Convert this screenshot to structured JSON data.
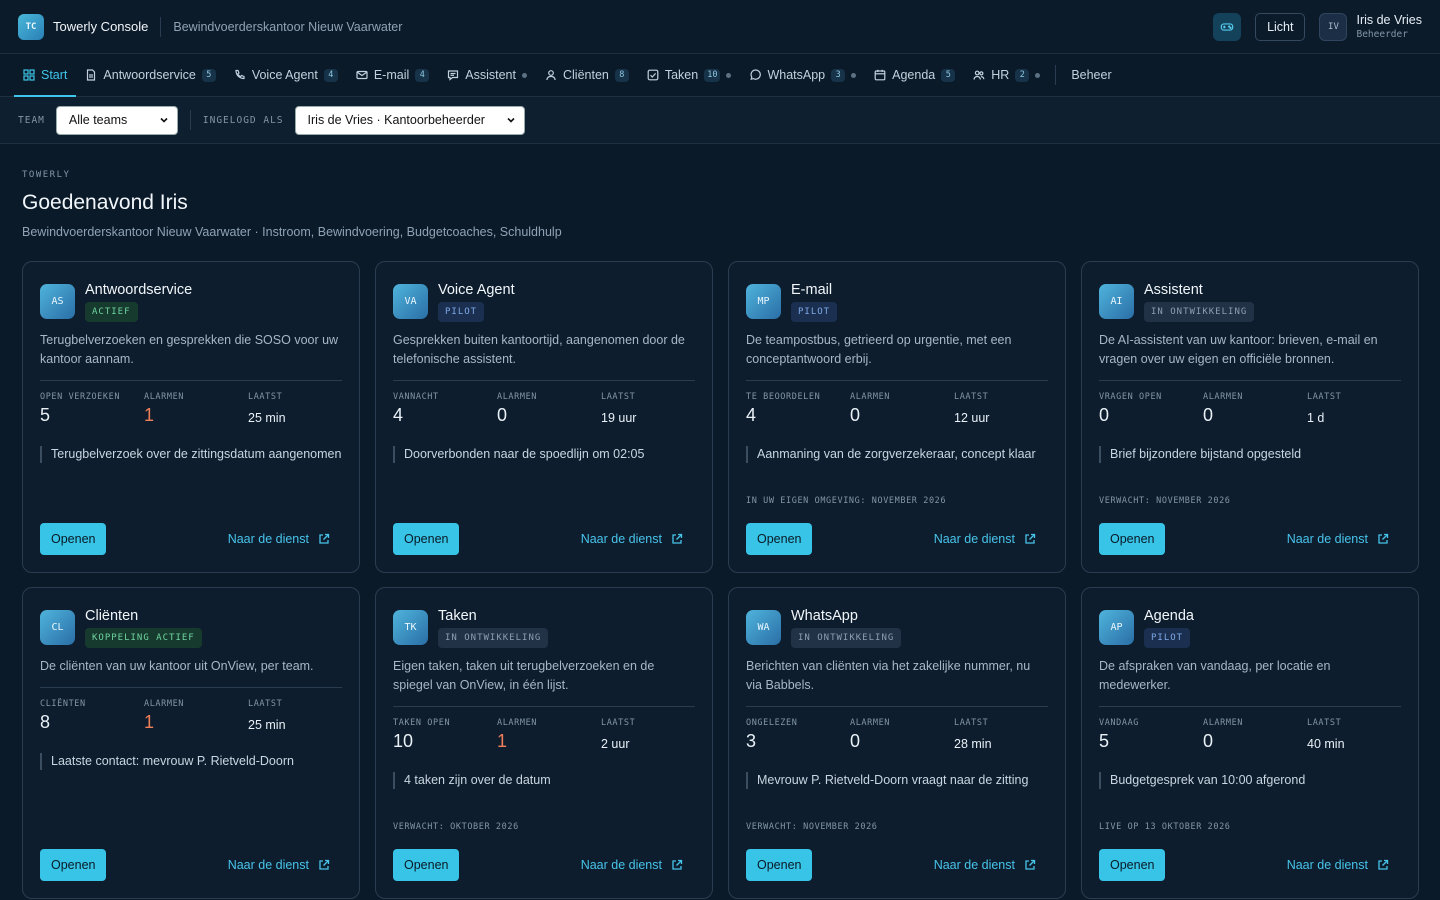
{
  "app": {
    "logo": "TC",
    "title": "Towerly Console",
    "org": "Bewindvoerderskantoor Nieuw Vaarwater"
  },
  "header": {
    "theme_button": "Licht",
    "theme_icon": "gamepad-icon",
    "user": {
      "initials": "IV",
      "name": "Iris de Vries",
      "role": "Beheerder"
    }
  },
  "nav": {
    "items": [
      {
        "label": "Start",
        "icon": "grid-icon",
        "active": true
      },
      {
        "label": "Antwoordservice",
        "icon": "document-icon",
        "badge": "5"
      },
      {
        "label": "Voice Agent",
        "icon": "phone-icon",
        "badge": "4"
      },
      {
        "label": "E-mail",
        "icon": "mail-icon",
        "badge": "4"
      },
      {
        "label": "Assistent",
        "icon": "chat-icon",
        "dot": true
      },
      {
        "label": "Cliënten",
        "icon": "user-icon",
        "badge": "8"
      },
      {
        "label": "Taken",
        "icon": "checkbox-icon",
        "badge": "10",
        "dot": true
      },
      {
        "label": "WhatsApp",
        "icon": "whatsapp-icon",
        "badge": "3",
        "dot": true
      },
      {
        "label": "Agenda",
        "icon": "calendar-icon",
        "badge": "5"
      },
      {
        "label": "HR",
        "icon": "people-icon",
        "badge": "2",
        "dot": true
      }
    ],
    "admin": "Beheer"
  },
  "filters": {
    "team_label": "TEAM",
    "team_value": "Alle teams",
    "login_label": "INGELOGD ALS",
    "login_value": "Iris de Vries · Kantoorbeheerder"
  },
  "page": {
    "eyebrow": "TOWERLY",
    "greeting": "Goedenavond Iris",
    "subline": "Bewindvoerderskantoor Nieuw Vaarwater · Instroom, Bewindvoering, Budgetcoaches, Schuldhulp"
  },
  "cards": [
    {
      "tile": "AS",
      "title": "Antwoordservice",
      "status": "ACTIEF",
      "status_color": "#6fd3a0",
      "desc": "Terugbelverzoeken en gesprekken die SOSO voor uw kantoor aannam.",
      "stat1_label": "OPEN VERZOEKEN",
      "stat1": "5",
      "alarm_label": "ALARMEN",
      "alarm": "1",
      "last_label": "LAATST",
      "last": "25 min",
      "note": "Terugbelverzoek over de zittingsdatum aangenomen",
      "expect": "",
      "open": "Openen",
      "link": "Naar de dienst"
    },
    {
      "tile": "VA",
      "title": "Voice Agent",
      "status": "PILOT",
      "status_color": "#7ea8e6",
      "desc": "Gesprekken buiten kantoortijd, aangenomen door de telefonische assistent.",
      "stat1_label": "VANNACHT",
      "stat1": "4",
      "alarm_label": "ALARMEN",
      "alarm": "0",
      "last_label": "LAATST",
      "last": "19 uur",
      "note": "Doorverbonden naar de spoedlijn om 02:05",
      "expect": "",
      "open": "Openen",
      "link": "Naar de dienst"
    },
    {
      "tile": "MP",
      "title": "E-mail",
      "status": "PILOT",
      "status_color": "#7ea8e6",
      "desc": "De teampostbus, getrieerd op urgentie, met een conceptantwoord erbij.",
      "stat1_label": "TE BEOORDELEN",
      "stat1": "4",
      "alarm_label": "ALARMEN",
      "alarm": "0",
      "last_label": "LAATST",
      "last": "12 uur",
      "note": "Aanmaning van de zorgverzekeraar, concept klaar",
      "expect": "IN UW EIGEN OMGEVING: NOVEMBER 2026",
      "open": "Openen",
      "link": "Naar de dienst"
    },
    {
      "tile": "AI",
      "title": "Assistent",
      "status": "IN ONTWIKKELING",
      "status_color": "#8c9eb1",
      "desc": "De AI-assistent van uw kantoor: brieven, e-mail en vragen over uw eigen en officiële bronnen.",
      "stat1_label": "VRAGEN OPEN",
      "stat1": "0",
      "alarm_label": "ALARMEN",
      "alarm": "0",
      "last_label": "LAATST",
      "last": "1 d",
      "note": "Brief bijzondere bijstand opgesteld",
      "expect": "VERWACHT: NOVEMBER 2026",
      "open": "Openen",
      "link": "Naar de dienst"
    },
    {
      "tile": "CL",
      "title": "Cliënten",
      "status": "KOPPELING ACTIEF",
      "status_color": "#6fd3a0",
      "desc": "De cliënten van uw kantoor uit OnView, per team.",
      "stat1_label": "CLIËNTEN",
      "stat1": "8",
      "alarm_label": "ALARMEN",
      "alarm": "1",
      "last_label": "LAATST",
      "last": "25 min",
      "note": "Laatste contact: mevrouw P. Rietveld-Doorn",
      "expect": "",
      "open": "Openen",
      "link": "Naar de dienst"
    },
    {
      "tile": "TK",
      "title": "Taken",
      "status": "IN ONTWIKKELING",
      "status_color": "#8c9eb1",
      "desc": "Eigen taken, taken uit terugbelverzoeken en de spiegel van OnView, in één lijst.",
      "stat1_label": "TAKEN OPEN",
      "stat1": "10",
      "alarm_label": "ALARMEN",
      "alarm": "1",
      "last_label": "LAATST",
      "last": "2 uur",
      "note": "4 taken zijn over de datum",
      "expect": "VERWACHT: OKTOBER 2026",
      "open": "Openen",
      "link": "Naar de dienst"
    },
    {
      "tile": "WA",
      "title": "WhatsApp",
      "status": "IN ONTWIKKELING",
      "status_color": "#8c9eb1",
      "desc": "Berichten van cliënten via het zakelijke nummer, nu via Babbels.",
      "stat1_label": "ONGELEZEN",
      "stat1": "3",
      "alarm_label": "ALARMEN",
      "alarm": "0",
      "last_label": "LAATST",
      "last": "28 min",
      "note": "Mevrouw P. Rietveld-Doorn vraagt naar de zitting",
      "expect": "VERWACHT: NOVEMBER 2026",
      "open": "Openen",
      "link": "Naar de dienst"
    },
    {
      "tile": "AP",
      "title": "Agenda",
      "status": "PILOT",
      "status_color": "#7ea8e6",
      "desc": "De afspraken van vandaag, per locatie en medewerker.",
      "stat1_label": "VANDAAG",
      "stat1": "5",
      "alarm_label": "ALARMEN",
      "alarm": "0",
      "last_label": "LAATST",
      "last": "40 min",
      "note": "Budgetgesprek van 10:00 afgerond",
      "expect": "LIVE OP 13 OKTOBER 2026",
      "open": "Openen",
      "link": "Naar de dienst"
    }
  ],
  "colors": {
    "accent": "#3fc6ea",
    "alarm": "#ef7f5b",
    "background": "#0b1a29"
  }
}
